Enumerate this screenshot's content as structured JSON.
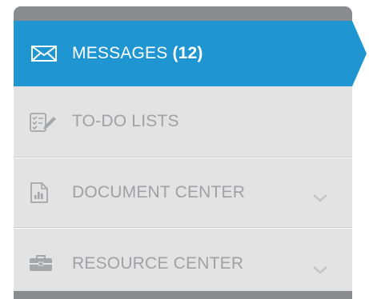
{
  "menu": {
    "items": [
      {
        "label": "MESSAGES",
        "count": "(12)",
        "icon": "envelope-icon",
        "active": true
      },
      {
        "label": "TO-DO LISTS",
        "icon": "checklist-pen-icon",
        "active": false
      },
      {
        "label": "DOCUMENT CENTER",
        "icon": "document-chart-icon",
        "active": false,
        "expandable": true
      },
      {
        "label": "RESOURCE CENTER",
        "icon": "briefcase-icon",
        "active": false,
        "expandable": true
      }
    ]
  },
  "colors": {
    "active_bg": "#1f96d2",
    "item_bg": "#e3e3e4",
    "item_text": "#a0a1a3",
    "frame": "#898b8f"
  }
}
